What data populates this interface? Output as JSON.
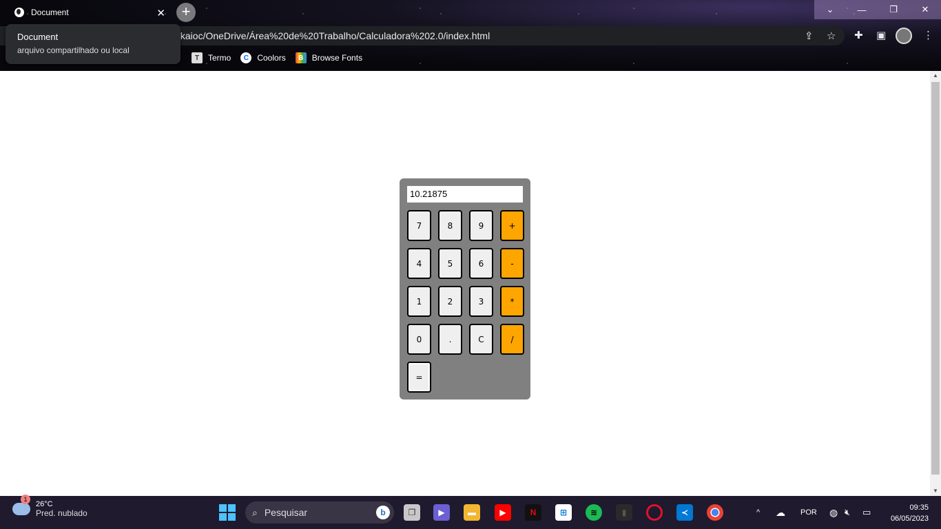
{
  "browser": {
    "tab_title": "Document",
    "tab_close": "✕",
    "new_tab": "+",
    "url": "/kaioc/OneDrive/Área%20de%20Trabalho/Calculadora%202.0/index.html",
    "tooltip_title": "Document",
    "tooltip_subtitle": "arquivo compartilhado ou local",
    "bookmarks": [
      {
        "label": "Termo",
        "icon": "T"
      },
      {
        "label": "Coolors",
        "icon": "C"
      },
      {
        "label": "Browse Fonts",
        "icon": "B"
      }
    ],
    "window_controls": {
      "chevron": "⌄",
      "minimize": "—",
      "restore": "❐",
      "close": "✕"
    }
  },
  "calculator": {
    "display_value": "10.21875",
    "keys": [
      {
        "label": "7",
        "type": "num"
      },
      {
        "label": "8",
        "type": "num"
      },
      {
        "label": "9",
        "type": "num"
      },
      {
        "label": "+",
        "type": "op"
      },
      {
        "label": "4",
        "type": "num"
      },
      {
        "label": "5",
        "type": "num"
      },
      {
        "label": "6",
        "type": "num"
      },
      {
        "label": "-",
        "type": "op"
      },
      {
        "label": "1",
        "type": "num"
      },
      {
        "label": "2",
        "type": "num"
      },
      {
        "label": "3",
        "type": "num"
      },
      {
        "label": "*",
        "type": "op"
      },
      {
        "label": "0",
        "type": "num"
      },
      {
        "label": ".",
        "type": "num"
      },
      {
        "label": "C",
        "type": "num"
      },
      {
        "label": "/",
        "type": "op"
      },
      {
        "label": "=",
        "type": "eq"
      }
    ]
  },
  "taskbar": {
    "weather_badge": "1",
    "weather_temp": "26°C",
    "weather_desc": "Pred. nublado",
    "search_placeholder": "Pesquisar",
    "language": "POR",
    "time": "09:35",
    "date": "06/05/2023"
  },
  "colors": {
    "operator_key": "#ffa500",
    "calc_body": "#808080",
    "key_bg": "#efefef",
    "taskbar_bg": "#1f1a2e"
  }
}
